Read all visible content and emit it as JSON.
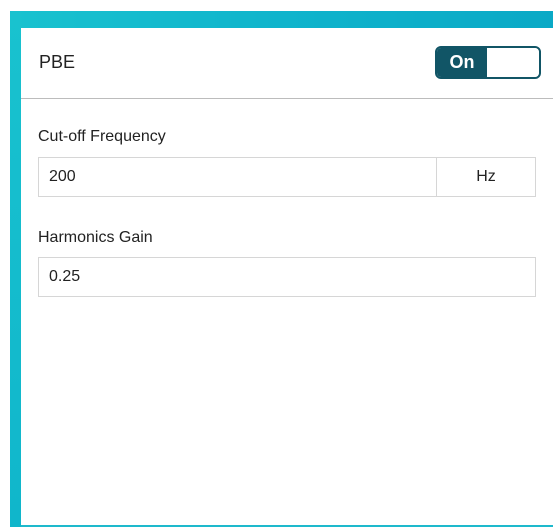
{
  "header": {
    "title": "PBE",
    "toggle_label": "On",
    "toggle_state": "on"
  },
  "fields": {
    "cutoff": {
      "label": "Cut-off Frequency",
      "value": "200",
      "unit": "Hz"
    },
    "harmonics": {
      "label": "Harmonics Gain",
      "value": "0.25"
    }
  },
  "colors": {
    "frame_accent": "#1ab9cc",
    "toggle_fill": "#115566",
    "divider": "#bcbcbc",
    "input_border": "#d6d6d6",
    "text": "#222222"
  }
}
